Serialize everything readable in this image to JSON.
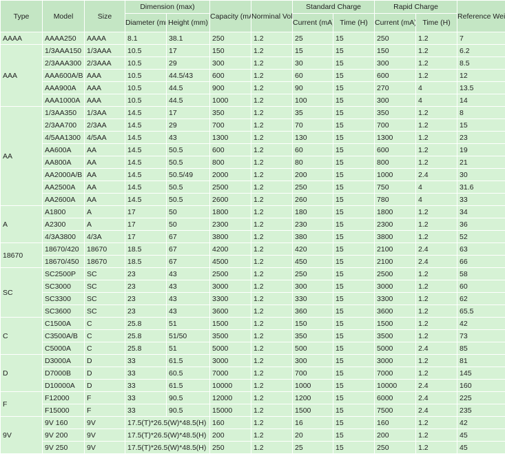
{
  "headers": {
    "type": "Type",
    "model": "Model",
    "size": "Size",
    "dimension": "Dimension (max)",
    "diameter": "Diameter (mm)",
    "height": "Height (mm)",
    "capacity": "Capacity (mAH)",
    "voltage": "Norminal Voltage(V)",
    "standard_charge": "Standard Charge",
    "rapid_charge": "Rapid Charge",
    "current": "Current (mA)",
    "time": "Time (H)",
    "weight": "Reference Weight(g)"
  },
  "groups": [
    {
      "type": "AAAA",
      "rows": [
        [
          "AAAA250",
          "AAAA",
          "8.1",
          "38.1",
          "250",
          "1.2",
          "25",
          "15",
          "250",
          "1.2",
          "7"
        ]
      ]
    },
    {
      "type": "AAA",
      "rows": [
        [
          "1/3AAA150",
          "1/3AAA",
          "10.5",
          "17",
          "150",
          "1.2",
          "15",
          "15",
          "150",
          "1.2",
          "6.2"
        ],
        [
          "2/3AAA300",
          "2/3AAA",
          "10.5",
          "29",
          "300",
          "1.2",
          "30",
          "15",
          "300",
          "1.2",
          "8.5"
        ],
        [
          "AAA600A/B",
          "AAA",
          "10.5",
          "44.5/43",
          "600",
          "1.2",
          "60",
          "15",
          "600",
          "1.2",
          "12"
        ],
        [
          "AAA900A",
          "AAA",
          "10.5",
          "44.5",
          "900",
          "1.2",
          "90",
          "15",
          "270",
          "4",
          "13.5"
        ],
        [
          "AAA1000A",
          "AAA",
          "10.5",
          "44.5",
          "1000",
          "1.2",
          "100",
          "15",
          "300",
          "4",
          "14"
        ]
      ]
    },
    {
      "type": "AA",
      "rows": [
        [
          "1/3AA350",
          "1/3AA",
          "14.5",
          "17",
          "350",
          "1.2",
          "35",
          "15",
          "350",
          "1.2",
          "8"
        ],
        [
          "2/3AA700",
          "2/3AA",
          "14.5",
          "29",
          "700",
          "1.2",
          "70",
          "15",
          "700",
          "1.2",
          "15"
        ],
        [
          "4/5AA1300",
          "4/5AA",
          "14.5",
          "43",
          "1300",
          "1.2",
          "130",
          "15",
          "1300",
          "1.2",
          "23"
        ],
        [
          "AA600A",
          "AA",
          "14.5",
          "50.5",
          "600",
          "1.2",
          "60",
          "15",
          "600",
          "1.2",
          "19"
        ],
        [
          "AA800A",
          "AA",
          "14.5",
          "50.5",
          "800",
          "1.2",
          "80",
          "15",
          "800",
          "1.2",
          "21"
        ],
        [
          "AA2000A/B",
          "AA",
          "14.5",
          "50.5/49",
          "2000",
          "1.2",
          "200",
          "15",
          "1000",
          "2.4",
          "30"
        ],
        [
          "AA2500A",
          "AA",
          "14.5",
          "50.5",
          "2500",
          "1.2",
          "250",
          "15",
          "750",
          "4",
          "31.6"
        ],
        [
          "AA2600A",
          "AA",
          "14.5",
          "50.5",
          "2600",
          "1.2",
          "260",
          "15",
          "780",
          "4",
          "33"
        ]
      ]
    },
    {
      "type": "A",
      "rows": [
        [
          "A1800",
          "A",
          "17",
          "50",
          "1800",
          "1.2",
          "180",
          "15",
          "1800",
          "1.2",
          "34"
        ],
        [
          "A2300",
          "A",
          "17",
          "50",
          "2300",
          "1.2",
          "230",
          "15",
          "2300",
          "1.2",
          "36"
        ],
        [
          "4/3A3800",
          "4/3A",
          "17",
          "67",
          "3800",
          "1.2",
          "380",
          "15",
          "3800",
          "1.2",
          "52"
        ]
      ]
    },
    {
      "type": "18670",
      "rows": [
        [
          "18670/420",
          "18670",
          "18.5",
          "67",
          "4200",
          "1.2",
          "420",
          "15",
          "2100",
          "2.4",
          "63"
        ],
        [
          "18670/450",
          "18670",
          "18.5",
          "67",
          "4500",
          "1.2",
          "450",
          "15",
          "2100",
          "2.4",
          "66"
        ]
      ]
    },
    {
      "type": "SC",
      "rows": [
        [
          "SC2500P",
          "SC",
          "23",
          "43",
          "2500",
          "1.2",
          "250",
          "15",
          "2500",
          "1.2",
          "58"
        ],
        [
          "SC3000",
          "SC",
          "23",
          "43",
          "3000",
          "1.2",
          "300",
          "15",
          "3000",
          "1.2",
          "60"
        ],
        [
          "SC3300",
          "SC",
          "23",
          "43",
          "3300",
          "1.2",
          "330",
          "15",
          "3300",
          "1.2",
          "62"
        ],
        [
          "SC3600",
          "SC",
          "23",
          "43",
          "3600",
          "1.2",
          "360",
          "15",
          "3600",
          "1.2",
          "65.5"
        ]
      ]
    },
    {
      "type": "C",
      "rows": [
        [
          "C1500A",
          "C",
          "25.8",
          "51",
          "1500",
          "1.2",
          "150",
          "15",
          "1500",
          "1.2",
          "42"
        ],
        [
          "C3500A/B",
          "C",
          "25.8",
          "51/50",
          "3500",
          "1.2",
          "350",
          "15",
          "3500",
          "1.2",
          "73"
        ],
        [
          "C5000A",
          "C",
          "25.8",
          "51",
          "5000",
          "1.2",
          "500",
          "15",
          "5000",
          "2.4",
          "85"
        ]
      ]
    },
    {
      "type": "D",
      "rows": [
        [
          "D3000A",
          "D",
          "33",
          "61.5",
          "3000",
          "1.2",
          "300",
          "15",
          "3000",
          "1.2",
          "81"
        ],
        [
          "D7000B",
          "D",
          "33",
          "60.5",
          "7000",
          "1.2",
          "700",
          "15",
          "7000",
          "1.2",
          "145"
        ],
        [
          "D10000A",
          "D",
          "33",
          "61.5",
          "10000",
          "1.2",
          "1000",
          "15",
          "10000",
          "2.4",
          "160"
        ]
      ]
    },
    {
      "type": "F",
      "rows": [
        [
          "F12000",
          "F",
          "33",
          "90.5",
          "12000",
          "1.2",
          "1200",
          "15",
          "6000",
          "2.4",
          "225"
        ],
        [
          "F15000",
          "F",
          "33",
          "90.5",
          "15000",
          "1.2",
          "1500",
          "15",
          "7500",
          "2.4",
          "235"
        ]
      ]
    },
    {
      "type": "9V",
      "rows": [
        [
          "9V 160",
          "9V",
          "17.5(T)*26.5(W)*48.5(H)",
          "",
          "160",
          "1.2",
          "16",
          "15",
          "160",
          "1.2",
          "42"
        ],
        [
          "9V 200",
          "9V",
          "17.5(T)*26.5(W)*48.5(H)",
          "",
          "200",
          "1.2",
          "20",
          "15",
          "200",
          "1.2",
          "45"
        ],
        [
          "9V 250",
          "9V",
          "17.5(T)*26.5(W)*48.5(H)",
          "",
          "250",
          "1.2",
          "25",
          "15",
          "250",
          "1.2",
          "45"
        ]
      ]
    }
  ]
}
